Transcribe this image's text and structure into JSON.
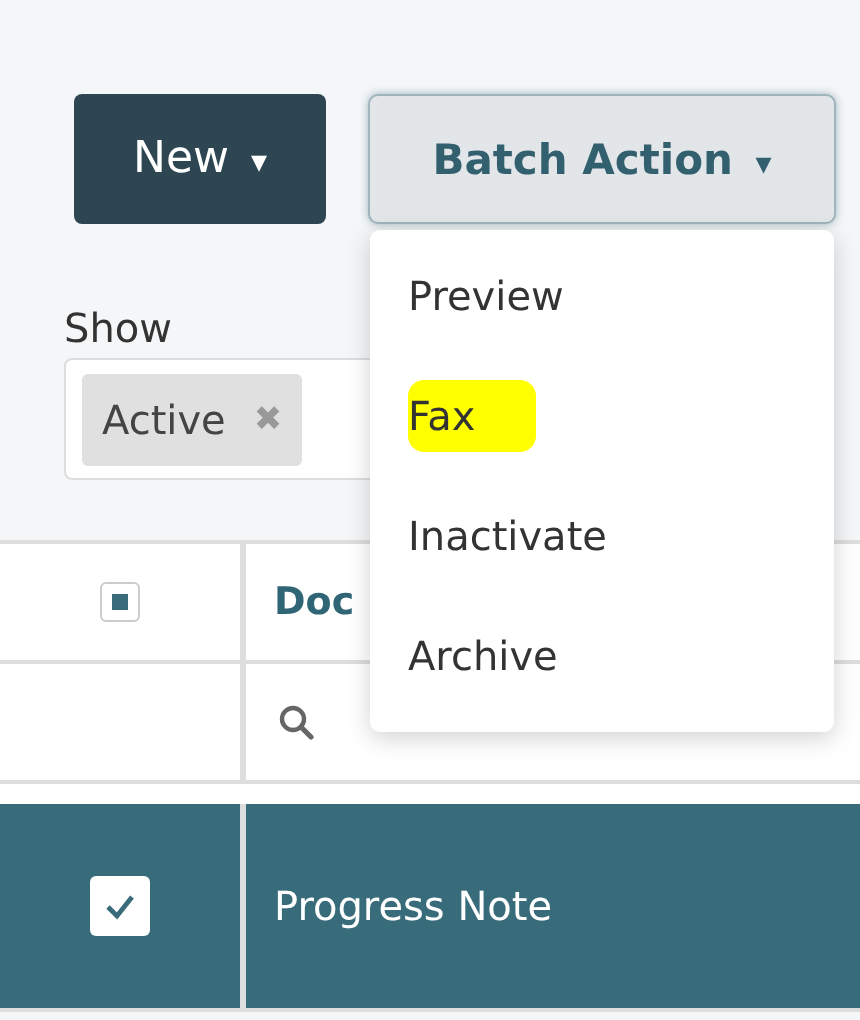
{
  "toolbar": {
    "new_button": {
      "label": "New",
      "caret": "▾"
    },
    "batch_button": {
      "label": "Batch Action",
      "caret": "▾",
      "expanded": true
    }
  },
  "batch_menu": [
    {
      "label": "Preview",
      "highlighted": false
    },
    {
      "label": "Fax",
      "highlighted": true
    },
    {
      "label": "Inactivate",
      "highlighted": false
    },
    {
      "label": "Archive",
      "highlighted": false
    }
  ],
  "filter": {
    "label": "Show",
    "tags": [
      {
        "label": "Active",
        "remove": "✖"
      }
    ]
  },
  "table": {
    "select_all": {
      "indeterminate": true
    },
    "columns": [
      {
        "label": "Doc"
      }
    ],
    "rows": [
      {
        "checked": true,
        "selected": true,
        "cells": [
          "Progress Note"
        ]
      }
    ]
  }
}
